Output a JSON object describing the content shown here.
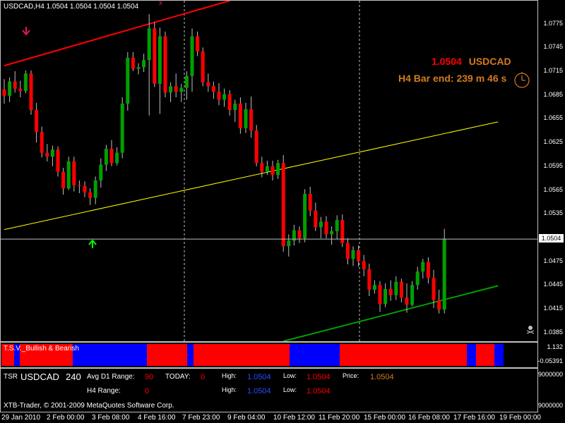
{
  "chart_header": "USDCAD,H4  1.0504 1.0504 1.0504 1.0504",
  "overlay": {
    "price": "1.0504",
    "symbol": "USDCAD",
    "bar_end": "H4 Bar end: 239 m 46 s"
  },
  "price_axis": [
    "1.0775",
    "1.0745",
    "1.0715",
    "1.0685",
    "1.0655",
    "1.0625",
    "1.0595",
    "1.0565",
    "1.0535",
    "1.0475",
    "1.0445",
    "1.0415",
    "1.0385"
  ],
  "current_price_label": "1.0504",
  "indicator": {
    "title": "T.S.V._Bullish & Bearish",
    "scale_top": "1.132",
    "scale_bottom": "-0.05391",
    "strip": "RRRRBBRRRRRRRRRRRRRRRRRBBBBBBBBBBBBBBBBBBBBBBBBRRRRRRRRRRRRRBBRRRRRRRRRRRRRRRRRRRRRRRRRRRRRRRBBBBBBBBBBBBBBBBRRRRRRRRRRRRRRRRRRRRRRRRRRRRRRRRRRRRRRRRRBBBRRRRRRBBB",
    "colors": {
      "R": "#ff0000",
      "B": "#0000ff"
    }
  },
  "tsr": {
    "name": "TSR",
    "symbol": "USDCAD",
    "period": "240",
    "avg_d1_label": "Avg D1 Range:",
    "avg_d1_value": "90",
    "today_label": "TODAY:",
    "today_value": "0",
    "h4_label": "H4 Range:",
    "h4_value": "0",
    "high_label": "High:",
    "high_value": "1.0504",
    "low_label": "Low:",
    "low_value": "1.0504",
    "price_label": "Price:",
    "price_value": "1.0504",
    "high2_label": "High:",
    "high2_value": "1.0504",
    "low2_label": "Low:",
    "low2_value": "1.0504",
    "scale_top": "9000000",
    "scale_bottom": "9000000",
    "copyright": "XTB-Trader, © 2001-2009 MetaQuotes Software Corp."
  },
  "time_axis": [
    "29 Jan 2010",
    "2 Feb 00:00",
    "3 Feb 08:00",
    "4 Feb 16:00",
    "7 Feb 23:00",
    "9 Feb 04:00",
    "10 Feb 12:00",
    "11 Feb 20:00",
    "15 Feb 00:00",
    "16 Feb 08:00",
    "17 Feb 16:00",
    "19 Feb 00:00"
  ],
  "chart_data": {
    "type": "candlestick",
    "symbol": "USDCAD",
    "timeframe": "H4",
    "ylim": [
      1.0375,
      1.0805
    ],
    "current_price": 1.0504,
    "candles": [
      [
        1.0693,
        1.0706,
        1.0675,
        1.0685
      ],
      [
        1.0685,
        1.0708,
        1.0677,
        1.0703
      ],
      [
        1.0703,
        1.0716,
        1.0689,
        1.0694
      ],
      [
        1.0694,
        1.0704,
        1.0683,
        1.0691
      ],
      [
        1.0691,
        1.0717,
        1.0688,
        1.0713
      ],
      [
        1.0713,
        1.0717,
        1.0661,
        1.0667
      ],
      [
        1.0667,
        1.0676,
        1.0626,
        1.0639
      ],
      [
        1.0639,
        1.0646,
        1.0607,
        1.0613
      ],
      [
        1.0613,
        1.0624,
        1.0602,
        1.0608
      ],
      [
        1.0608,
        1.0622,
        1.0596,
        1.0617
      ],
      [
        1.0617,
        1.0621,
        1.0583,
        1.0589
      ],
      [
        1.0589,
        1.0594,
        1.056,
        1.0568
      ],
      [
        1.0568,
        1.0608,
        1.0566,
        1.0602
      ],
      [
        1.0602,
        1.0608,
        1.0564,
        1.0572
      ],
      [
        1.0572,
        1.0578,
        1.0562,
        1.0571
      ],
      [
        1.0571,
        1.0577,
        1.0557,
        1.0563
      ],
      [
        1.0563,
        1.0568,
        1.0547,
        1.0556
      ],
      [
        1.0556,
        1.0583,
        1.0548,
        1.0578
      ],
      [
        1.0578,
        1.0606,
        1.0569,
        1.0598
      ],
      [
        1.0598,
        1.0623,
        1.059,
        1.0618
      ],
      [
        1.0618,
        1.0629,
        1.0596,
        1.06
      ],
      [
        1.06,
        1.062,
        1.0597,
        1.0613
      ],
      [
        1.0613,
        1.0683,
        1.0606,
        1.0675
      ],
      [
        1.0675,
        1.074,
        1.0666,
        1.0733
      ],
      [
        1.0733,
        1.074,
        1.0716,
        1.0719
      ],
      [
        1.0719,
        1.0726,
        1.0712,
        1.0721
      ],
      [
        1.0721,
        1.0738,
        1.0715,
        1.073
      ],
      [
        1.073,
        1.0788,
        1.066,
        1.077
      ],
      [
        1.077,
        1.0778,
        1.0696,
        1.07
      ],
      [
        1.07,
        1.0771,
        1.0662,
        1.076
      ],
      [
        1.076,
        1.0766,
        1.0683,
        1.0689
      ],
      [
        1.0689,
        1.0702,
        1.0677,
        1.0697
      ],
      [
        1.0697,
        1.0713,
        1.0683,
        1.069
      ],
      [
        1.069,
        1.07,
        1.0677,
        1.0695
      ],
      [
        1.0695,
        1.0716,
        1.068,
        1.071
      ],
      [
        1.071,
        1.077,
        1.069,
        1.076
      ],
      [
        1.076,
        1.0766,
        1.0735,
        1.0741
      ],
      [
        1.0741,
        1.0746,
        1.0697,
        1.0702
      ],
      [
        1.0702,
        1.0713,
        1.069,
        1.0697
      ],
      [
        1.0697,
        1.0703,
        1.0681,
        1.069
      ],
      [
        1.069,
        1.0701,
        1.0673,
        1.068
      ],
      [
        1.068,
        1.0694,
        1.0671,
        1.0687
      ],
      [
        1.0687,
        1.0692,
        1.066,
        1.0667
      ],
      [
        1.0667,
        1.068,
        1.0652,
        1.0675
      ],
      [
        1.0675,
        1.0683,
        1.0637,
        1.0644
      ],
      [
        1.0644,
        1.0676,
        1.0638,
        1.0668
      ],
      [
        1.0668,
        1.0684,
        1.0632,
        1.0641
      ],
      [
        1.0641,
        1.0648,
        1.0596,
        1.06
      ],
      [
        1.06,
        1.0608,
        1.0582,
        1.0589
      ],
      [
        1.0589,
        1.0603,
        1.0585,
        1.0596
      ],
      [
        1.0596,
        1.0603,
        1.0578,
        1.0585
      ],
      [
        1.0585,
        1.0604,
        1.058,
        1.06
      ],
      [
        1.06,
        1.061,
        1.0488,
        1.0495
      ],
      [
        1.0495,
        1.051,
        1.0482,
        1.0502
      ],
      [
        1.0502,
        1.0522,
        1.0496,
        1.0515
      ],
      [
        1.0515,
        1.052,
        1.0499,
        1.0505
      ],
      [
        1.0505,
        1.0567,
        1.05,
        1.0561
      ],
      [
        1.0561,
        1.057,
        1.0533,
        1.054
      ],
      [
        1.054,
        1.055,
        1.0514,
        1.0519
      ],
      [
        1.0519,
        1.0532,
        1.0505,
        1.0526
      ],
      [
        1.0526,
        1.0533,
        1.0505,
        1.051
      ],
      [
        1.051,
        1.052,
        1.0497,
        1.0514
      ],
      [
        1.0514,
        1.0534,
        1.0504,
        1.0528
      ],
      [
        1.0528,
        1.0535,
        1.0494,
        1.0499
      ],
      [
        1.0499,
        1.0505,
        1.0472,
        1.0479
      ],
      [
        1.0479,
        1.0495,
        1.047,
        1.049
      ],
      [
        1.049,
        1.0496,
        1.0469,
        1.0476
      ],
      [
        1.0476,
        1.0484,
        1.0457,
        1.0466
      ],
      [
        1.0466,
        1.0473,
        1.0432,
        1.044
      ],
      [
        1.044,
        1.0452,
        1.0435,
        1.0446
      ],
      [
        1.0446,
        1.0451,
        1.0412,
        1.0422
      ],
      [
        1.0422,
        1.0448,
        1.0418,
        1.0441
      ],
      [
        1.0441,
        1.0452,
        1.0426,
        1.0433
      ],
      [
        1.0433,
        1.0457,
        1.0427,
        1.045
      ],
      [
        1.045,
        1.0454,
        1.0424,
        1.043
      ],
      [
        1.043,
        1.0448,
        1.0411,
        1.0421
      ],
      [
        1.0421,
        1.0451,
        1.0419,
        1.0446
      ],
      [
        1.0446,
        1.0469,
        1.044,
        1.0463
      ],
      [
        1.0463,
        1.0479,
        1.0454,
        1.0475
      ],
      [
        1.0475,
        1.0481,
        1.0448,
        1.0455
      ],
      [
        1.0455,
        1.0465,
        1.0417,
        1.0427
      ],
      [
        1.0427,
        1.044,
        1.041,
        1.0415
      ],
      [
        1.0415,
        1.0517,
        1.041,
        1.0504
      ]
    ],
    "indicators": {
      "upper_channel": {
        "color": "#ff0000",
        "from": [
          0,
          1.0723
        ],
        "to": [
          42,
          1.0805
        ]
      },
      "middle_line": {
        "color": "#ffff00",
        "from": [
          0,
          1.0516
        ],
        "to": [
          92,
          1.0652
        ]
      },
      "lower_channel": {
        "color": "#00a000",
        "from": [
          52,
          1.0375
        ],
        "to": [
          92,
          1.0445
        ]
      }
    }
  }
}
